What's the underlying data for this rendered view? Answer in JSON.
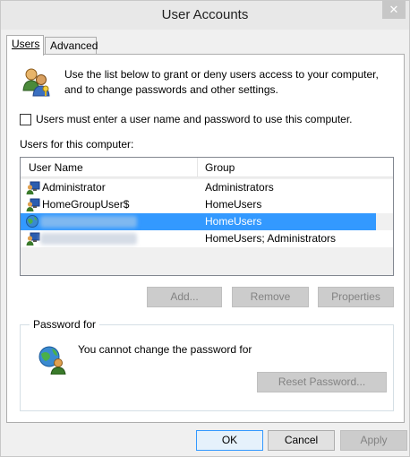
{
  "window": {
    "title": "User Accounts",
    "close_glyph": "✕"
  },
  "tabs": [
    {
      "label": "Users",
      "active": true
    },
    {
      "label": "Advanced",
      "active": false
    }
  ],
  "intro": {
    "line1": "Use the list below to grant or deny users access to your computer,",
    "line2": "and to change passwords and other settings."
  },
  "require_login": {
    "label": "Users must enter a user name and password to use this computer.",
    "checked": false
  },
  "users_list": {
    "label": "Users for this computer:",
    "columns": [
      "User Name",
      "Group"
    ],
    "rows": [
      {
        "name": "Administrator",
        "group": "Administrators",
        "name_obscured": false,
        "selected": false,
        "icon": "user-monitor-icon"
      },
      {
        "name": "HomeGroupUser$",
        "group": "HomeUsers",
        "name_obscured": false,
        "selected": false,
        "icon": "user-monitor-icon"
      },
      {
        "name": "",
        "group": "HomeUsers",
        "name_obscured": true,
        "selected": true,
        "icon": "user-globe-icon"
      },
      {
        "name": "",
        "group": "HomeUsers; Administrators",
        "name_obscured": true,
        "selected": false,
        "icon": "user-monitor-icon"
      }
    ]
  },
  "list_buttons": {
    "add": "Add...",
    "remove": "Remove",
    "properties": "Properties"
  },
  "password_group": {
    "title": "Password for",
    "message": "You cannot change the password for",
    "reset_button": "Reset Password..."
  },
  "dialog_buttons": {
    "ok": "OK",
    "cancel": "Cancel",
    "apply": "Apply"
  },
  "colors": {
    "selection": "#3399ff",
    "window_bg": "#f0f0f0"
  }
}
